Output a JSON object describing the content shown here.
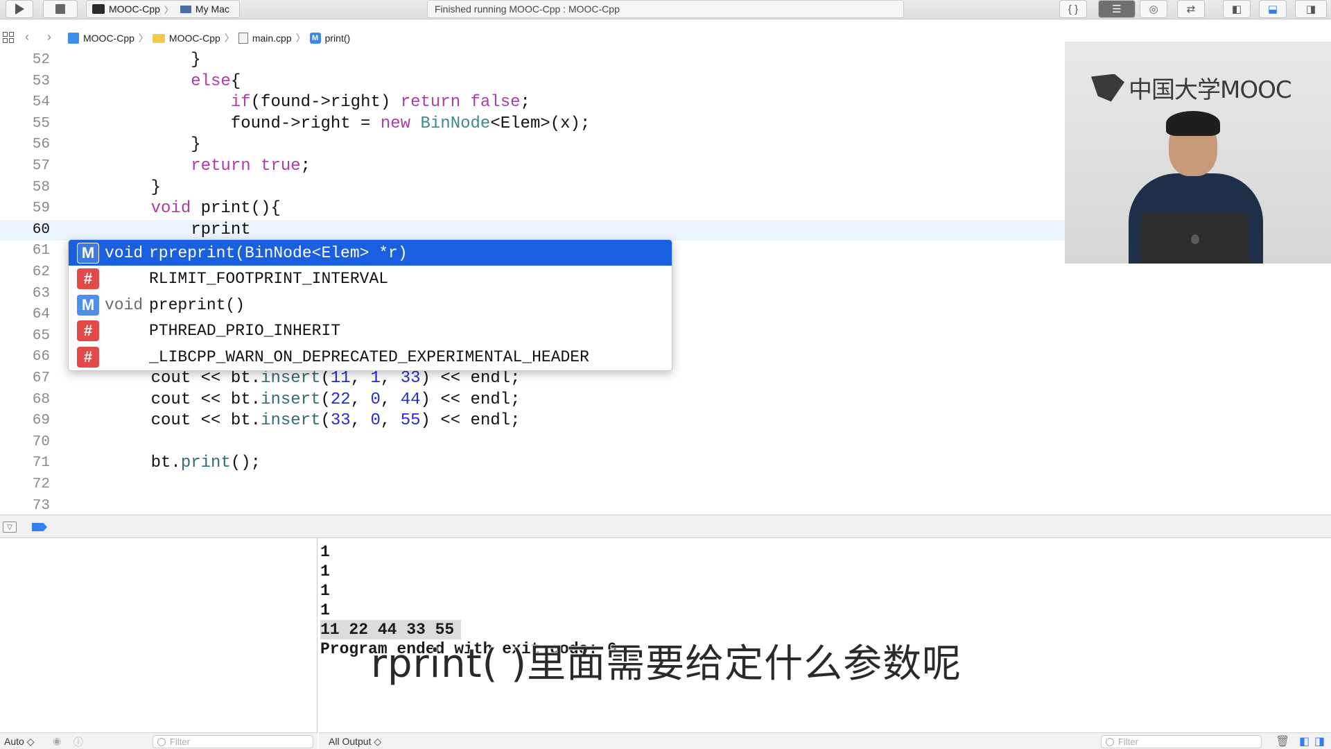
{
  "toolbar": {
    "scheme_project": "MOOC-Cpp",
    "scheme_device": "My Mac",
    "activity_text": "Finished running MOOC-Cpp : MOOC-Cpp"
  },
  "jumpbar": {
    "crumbs": [
      "MOOC-Cpp",
      "MOOC-Cpp",
      "main.cpp",
      "print()"
    ]
  },
  "editor": {
    "lines": [
      {
        "n": "52",
        "parts": [
          {
            "t": "        }",
            "c": ""
          }
        ]
      },
      {
        "n": "53",
        "parts": [
          {
            "t": "        ",
            "c": ""
          },
          {
            "t": "else",
            "c": "kw"
          },
          {
            "t": "{",
            "c": ""
          }
        ]
      },
      {
        "n": "54",
        "parts": [
          {
            "t": "            ",
            "c": ""
          },
          {
            "t": "if",
            "c": "kw"
          },
          {
            "t": "(found->right) ",
            "c": ""
          },
          {
            "t": "return",
            "c": "kw"
          },
          {
            "t": " ",
            "c": ""
          },
          {
            "t": "false",
            "c": "kw"
          },
          {
            "t": ";",
            "c": ""
          }
        ]
      },
      {
        "n": "55",
        "parts": [
          {
            "t": "            found->right = ",
            "c": ""
          },
          {
            "t": "new",
            "c": "kw"
          },
          {
            "t": " ",
            "c": ""
          },
          {
            "t": "BinNode",
            "c": "ty"
          },
          {
            "t": "<Elem>(x);",
            "c": ""
          }
        ]
      },
      {
        "n": "56",
        "parts": [
          {
            "t": "        }",
            "c": ""
          }
        ]
      },
      {
        "n": "57",
        "parts": [
          {
            "t": "        ",
            "c": ""
          },
          {
            "t": "return",
            "c": "kw"
          },
          {
            "t": " ",
            "c": ""
          },
          {
            "t": "true",
            "c": "kw"
          },
          {
            "t": ";",
            "c": ""
          }
        ]
      },
      {
        "n": "58",
        "parts": [
          {
            "t": "    }",
            "c": ""
          }
        ]
      },
      {
        "n": "59",
        "parts": [
          {
            "t": "    ",
            "c": ""
          },
          {
            "t": "void",
            "c": "kw"
          },
          {
            "t": " print(){",
            "c": ""
          }
        ]
      },
      {
        "n": "60",
        "parts": [
          {
            "t": "        rprint",
            "c": ""
          }
        ],
        "current": true
      },
      {
        "n": "61",
        "parts": []
      },
      {
        "n": "62",
        "parts": []
      },
      {
        "n": "63",
        "parts": []
      },
      {
        "n": "64",
        "parts": []
      },
      {
        "n": "65",
        "parts": []
      },
      {
        "n": "66",
        "parts": []
      },
      {
        "n": "67",
        "parts": [
          {
            "t": "    cout << bt.",
            "c": ""
          },
          {
            "t": "insert",
            "c": "fn"
          },
          {
            "t": "(",
            "c": ""
          },
          {
            "t": "11",
            "c": "num"
          },
          {
            "t": ", ",
            "c": ""
          },
          {
            "t": "1",
            "c": "num"
          },
          {
            "t": ", ",
            "c": ""
          },
          {
            "t": "33",
            "c": "num"
          },
          {
            "t": ") << endl;",
            "c": ""
          }
        ]
      },
      {
        "n": "68",
        "parts": [
          {
            "t": "    cout << bt.",
            "c": ""
          },
          {
            "t": "insert",
            "c": "fn"
          },
          {
            "t": "(",
            "c": ""
          },
          {
            "t": "22",
            "c": "num"
          },
          {
            "t": ", ",
            "c": ""
          },
          {
            "t": "0",
            "c": "num"
          },
          {
            "t": ", ",
            "c": ""
          },
          {
            "t": "44",
            "c": "num"
          },
          {
            "t": ") << endl;",
            "c": ""
          }
        ]
      },
      {
        "n": "69",
        "parts": [
          {
            "t": "    cout << bt.",
            "c": ""
          },
          {
            "t": "insert",
            "c": "fn"
          },
          {
            "t": "(",
            "c": ""
          },
          {
            "t": "33",
            "c": "num"
          },
          {
            "t": ", ",
            "c": ""
          },
          {
            "t": "0",
            "c": "num"
          },
          {
            "t": ", ",
            "c": ""
          },
          {
            "t": "55",
            "c": "num"
          },
          {
            "t": ") << endl;",
            "c": ""
          }
        ]
      },
      {
        "n": "70",
        "parts": []
      },
      {
        "n": "71",
        "parts": [
          {
            "t": "    bt.",
            "c": ""
          },
          {
            "t": "print",
            "c": "fn"
          },
          {
            "t": "();",
            "c": ""
          }
        ]
      },
      {
        "n": "72",
        "parts": []
      },
      {
        "n": "73",
        "parts": []
      }
    ]
  },
  "autocomplete": {
    "items": [
      {
        "kind": "M",
        "return_type": "void",
        "text": "rpreprint(BinNode<Elem> *r)",
        "selected": true
      },
      {
        "kind": "#",
        "return_type": "",
        "text": "RLIMIT_FOOTPRINT_INTERVAL",
        "selected": false
      },
      {
        "kind": "M",
        "return_type": "void",
        "text": "preprint()",
        "selected": false
      },
      {
        "kind": "#",
        "return_type": "",
        "text": "PTHREAD_PRIO_INHERIT",
        "selected": false
      },
      {
        "kind": "#",
        "return_type": "",
        "text": "_LIBCPP_WARN_ON_DEPRECATED_EXPERIMENTAL_HEADER",
        "selected": false
      }
    ]
  },
  "console": {
    "lines": [
      "1",
      "1",
      "1",
      "1",
      "11 22 44 33 55",
      "Program ended with exit code: 0"
    ]
  },
  "subtitle": "rprint( )里面需要给定什么参数呢",
  "statusbar": {
    "left_mode": "Auto ◇",
    "left_filter_placeholder": "Filter",
    "right_output": "All Output ◇",
    "right_filter_placeholder": "Filter"
  },
  "camera": {
    "logo_text": "中国大学MOOC"
  },
  "colors": {
    "keyword": "#ad3da4",
    "type": "#3b8c8c",
    "number": "#272ad8",
    "selection": "#1a5fe0",
    "macro_badge": "#e24a4a",
    "method_badge": "#4f8fea"
  }
}
